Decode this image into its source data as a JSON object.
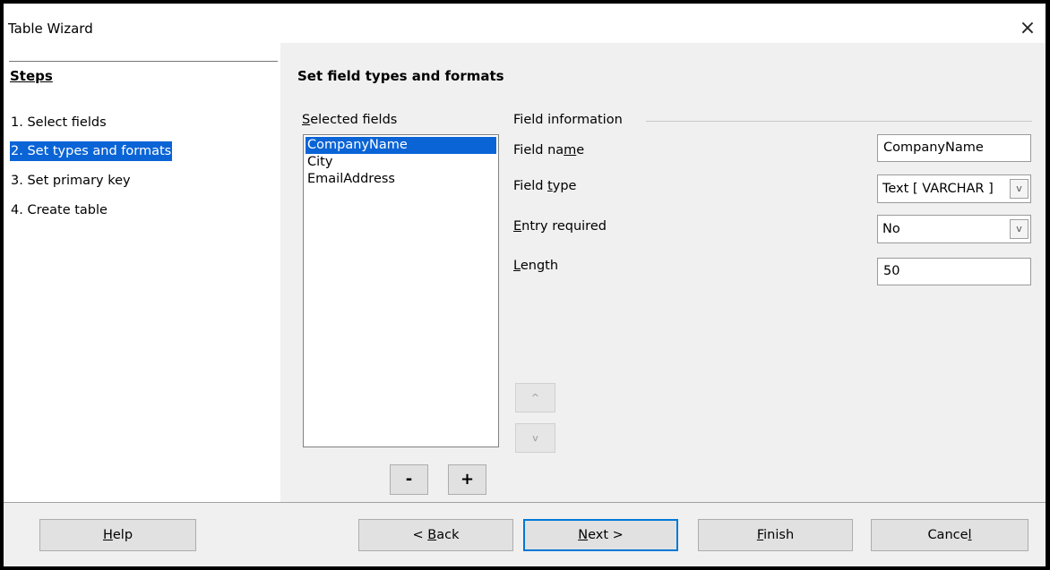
{
  "window": {
    "title": "Table Wizard",
    "close_glyph": "×"
  },
  "steps": {
    "heading": "Steps",
    "items": [
      {
        "label": "1. Select fields",
        "active": false
      },
      {
        "label": "2. Set types and formats",
        "active": true
      },
      {
        "label": "3. Set primary key",
        "active": false
      },
      {
        "label": "4. Create table",
        "active": false
      }
    ]
  },
  "main": {
    "title": "Set field types and formats",
    "selected_fields": {
      "label_first": "S",
      "label_rest": "elected fields",
      "items": [
        "CompanyName",
        "City",
        "EmailAddress"
      ],
      "selected_index": 0
    },
    "remove_label": "-",
    "add_label": "+",
    "up_glyph": "^",
    "down_glyph": "v"
  },
  "field_info": {
    "heading": "Field information",
    "field_name": {
      "label_a": "Field na",
      "label_u": "m",
      "label_b": "e",
      "value": "CompanyName"
    },
    "field_type": {
      "label_a": "Field ",
      "label_u": "t",
      "label_b": "ype",
      "value": "Text [ VARCHAR ]"
    },
    "entry_required": {
      "label_u": "E",
      "label_b": "ntry required",
      "value": "No"
    },
    "length": {
      "label_u": "L",
      "label_b": "ength",
      "value": "50"
    },
    "dropdown_glyph": "v"
  },
  "buttons": {
    "help": {
      "u": "H",
      "rest": "elp"
    },
    "back": {
      "pre": "< ",
      "u": "B",
      "rest": "ack"
    },
    "next": {
      "u": "N",
      "rest": "ext >"
    },
    "finish": {
      "u": "F",
      "rest": "inish"
    },
    "cancel": {
      "pre": "Cance",
      "u": "l"
    }
  },
  "colors": {
    "accent": "#0a64d6",
    "default_button_border": "#0078d7"
  }
}
